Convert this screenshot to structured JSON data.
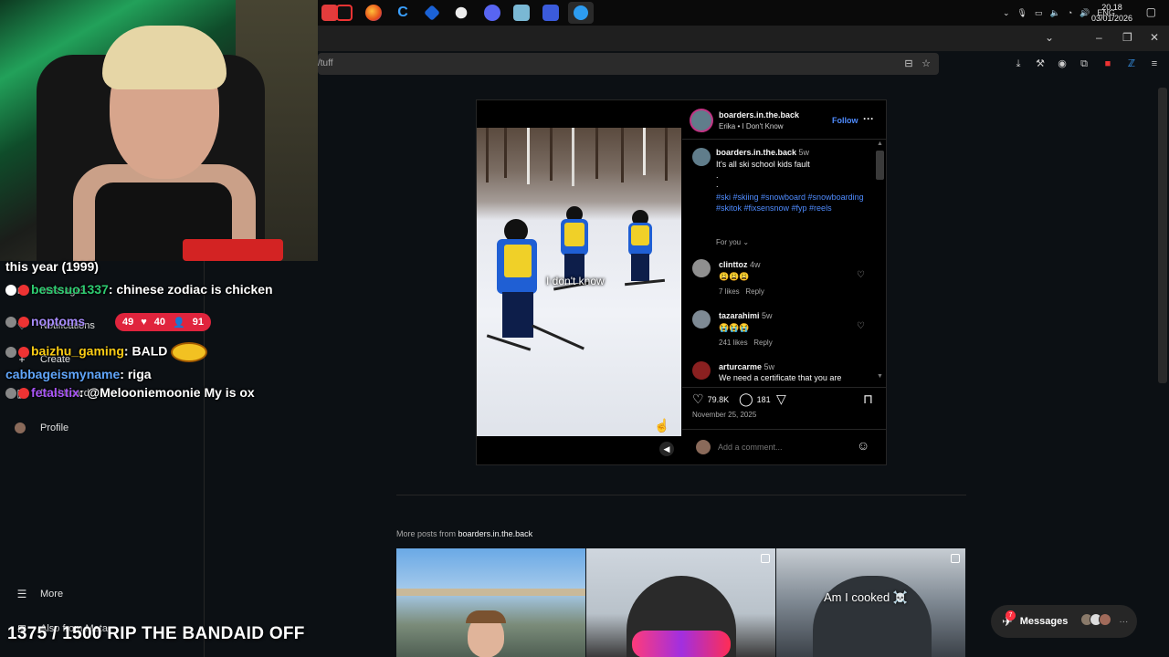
{
  "taskbar": {
    "tray": {
      "lang": "ENG",
      "time": "20.18",
      "date": "03/01/2026"
    },
    "app_icons": [
      "opera-gx-icon",
      "firefox-icon",
      "ccleaner-icon",
      "app-icon",
      "shield-app-icon",
      "discord-icon",
      "files-icon",
      "obs-icon",
      "browser-active-icon"
    ]
  },
  "browser": {
    "url": "/tuff"
  },
  "stream": {
    "chat": [
      {
        "text": "this year (1999)"
      },
      {
        "name": "bestsuo1337",
        "name_color": "#2ecc71",
        "text": "chinese zodiac is chicken"
      },
      {
        "name": "noptoms",
        "name_color": "#a78bfa",
        "text": ""
      },
      {
        "name": "baizhu_gaming",
        "name_color": "#facc15",
        "text": "BALD"
      },
      {
        "name": "cabbageismyname",
        "name_color": "#60a5fa",
        "text": "riga"
      },
      {
        "name": "fetalstix",
        "name_color": "#a855f7",
        "text": "@Melooniemoonie My is ox"
      }
    ],
    "live_counts": {
      "viewers": "49",
      "likes": "40",
      "people": "91"
    },
    "subgoal": "1375 / 1500 RIP THE BANDAID OFF"
  },
  "nav": {
    "messages": "Messages",
    "notifications": "Notifications",
    "create": "Create",
    "dashboard": "Dashboard",
    "profile": "Profile",
    "more": "More",
    "also_from_meta": "Also from Meta"
  },
  "post": {
    "username": "boarders.in.the.back",
    "audio": "Erika • I Don't Know",
    "follow": "Follow",
    "video_caption": "I don't know",
    "caption_user": "boarders.in.the.back",
    "caption_age": "5w",
    "caption_text": "It's all ski school kids fault",
    "caption_dots": ".",
    "hashtags": "#ski #skiing #snowboard #snowboarding #skitok #fixsensnow #fyp #reels",
    "for_you": "For you",
    "comments": [
      {
        "user": "clinttoz",
        "age": "4w",
        "text": "😩😩😩",
        "likes": "7 likes",
        "reply": "Reply"
      },
      {
        "user": "tazarahimi",
        "age": "5w",
        "text": "😭😭😭",
        "likes": "241 likes",
        "reply": "Reply"
      },
      {
        "user": "arturcarme",
        "age": "5w",
        "text": "We need a certificate that you are",
        "likes": "",
        "reply": ""
      }
    ],
    "like_count": "79.8K",
    "comment_count": "181",
    "date": "November 25, 2025",
    "add_comment_placeholder": "Add a comment..."
  },
  "more_posts": {
    "label": "More posts from",
    "username": "boarders.in.the.back",
    "thumbs": [
      {
        "caption": ""
      },
      {
        "caption": ""
      },
      {
        "caption": "Am I cooked ☠️"
      }
    ]
  },
  "messages_pill": {
    "label": "Messages",
    "badge": "7"
  }
}
